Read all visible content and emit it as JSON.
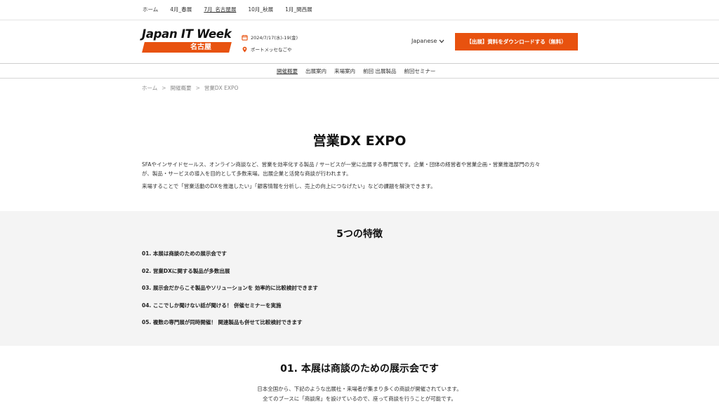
{
  "topbar": {
    "items": [
      {
        "label": "ホーム",
        "active": false
      },
      {
        "label": "4月_春展",
        "active": false
      },
      {
        "label": "7月_名古屋展",
        "active": true
      },
      {
        "label": "10月_秋展",
        "active": false
      },
      {
        "label": "1月_関西展",
        "active": false
      }
    ]
  },
  "header": {
    "logo_main": "Japan IT Week",
    "logo_sub": "名古屋",
    "date": "2024/7/17(水)-19(金)",
    "venue": "ポートメッセなごや",
    "language": "Japanese",
    "cta_label": "【出展】資料をダウンロードする（無料）"
  },
  "subnav": {
    "items": [
      {
        "label": "開催概要",
        "active": true
      },
      {
        "label": "出展案内",
        "active": false
      },
      {
        "label": "来場案内",
        "active": false
      },
      {
        "label": "前回 出展製品",
        "active": false
      },
      {
        "label": "前回セミナー",
        "active": false
      }
    ]
  },
  "breadcrumb": [
    "ホーム",
    "開催概要",
    "営業DX EXPO"
  ],
  "main": {
    "title": "営業DX EXPO",
    "intro_1_line1": "SFAやインサイドセールス、オンライン商談など、営業を効率化する製品 / サービスが一堂に出展する専門展です。企業・団体の経営者や営業企画・営業推進部門の方々",
    "intro_1_line2": "が、製品・サービスの導入を目的として多数来場。出展企業と活発な商談が行われます。",
    "intro_2": "来場することで「営業活動のDXを推進したい」「顧客情報を分析し、売上の向上につなげたい」などの課題を解決できます。"
  },
  "features": {
    "title": "5つの特徴",
    "items": [
      "01.  本展は商談のための展示会です",
      "02. 営業DXに関する製品が多数出展",
      "03. 展示会だからこそ製品やソリューションを 効率的に比較検討できます",
      "04. ここでしか聞けない話が聞ける！ 併催セミナーを実施",
      "05. 複数の専門展が同時開催！ 関連製品も併せて比較検討できます"
    ]
  },
  "section01": {
    "title": "01. 本展は商談のための展示会です",
    "line1": "日本全国から、下記のような出展社・来場者が集まり多くの商談が開催されています。",
    "line2": "全てのブースに「商談席」を設けているので、座って商談を行うことが可能です。"
  },
  "colors": {
    "accent": "#e8520f",
    "feature_bg": "#f4f4f4"
  },
  "icons": {
    "date": "calendar-icon",
    "venue": "location-pin-icon",
    "language": "chevron-down-icon"
  }
}
